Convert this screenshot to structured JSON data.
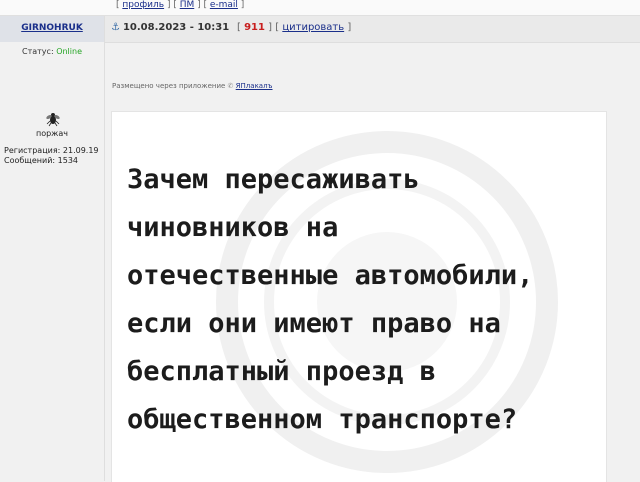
{
  "top_bar": {
    "links": [
      "профиль",
      "ПМ",
      "e-mail"
    ]
  },
  "author": {
    "name": "GIRNOHRUK",
    "status_label": "Статус:",
    "status_value": "Online",
    "title": "поржач",
    "registration": "Регистрация: 21.09.19",
    "messages": "Сообщений: 1534"
  },
  "post": {
    "datetime": "10.08.2023 - 10:31",
    "rating": "911",
    "quote_label": "цитировать",
    "via_prefix": "Размещено через приложение",
    "via_app": "ЯПлакалъ",
    "meme_text": "Зачем пересаживать\nчиновников на\nотечественные автомобили,\nесли они имеют право на\nбесплатный проезд в\nобщественном транспорте?"
  },
  "colors": {
    "link": "#1a2f8a",
    "online": "#26a526",
    "rating": "#c81e1e"
  }
}
